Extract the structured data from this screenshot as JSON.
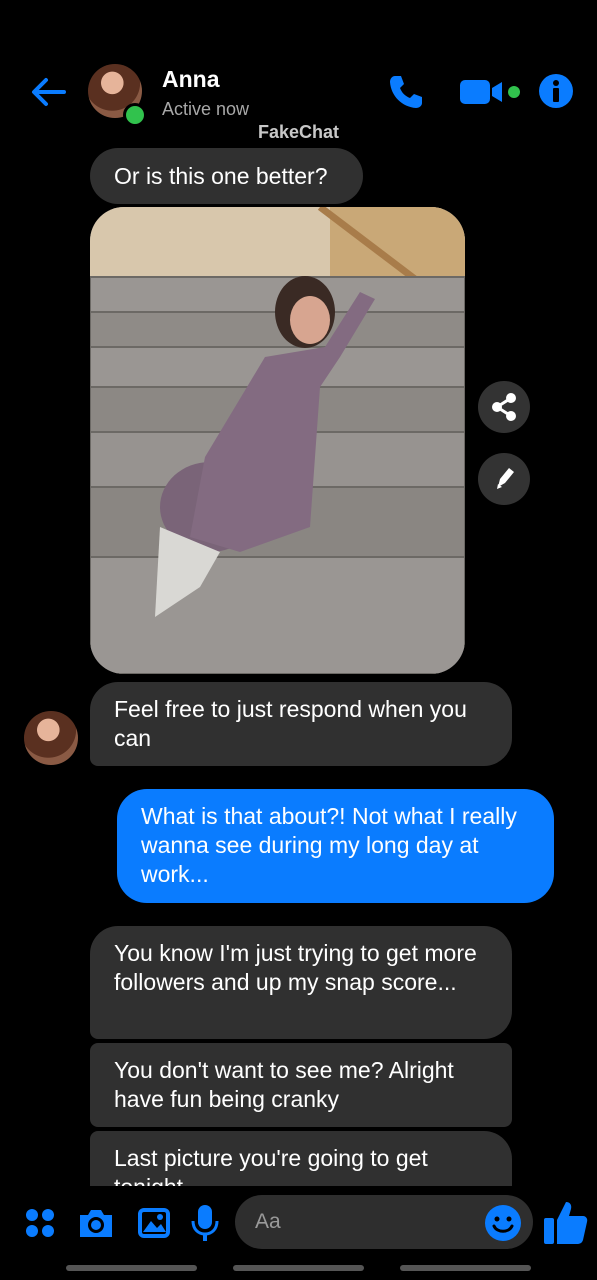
{
  "header": {
    "contact_name": "Anna",
    "status": "Active now",
    "watermark": "FakeChat",
    "accent": "#0a7cff",
    "online_color": "#31c24d"
  },
  "messages": [
    {
      "from": "contact",
      "text": "Or is this one better?"
    },
    {
      "from": "contact",
      "type": "photo"
    },
    {
      "from": "contact",
      "text": "Feel free to just respond when you can"
    },
    {
      "from": "me",
      "text": "What is that about?! Not what I really wanna see during my long day at work..."
    },
    {
      "from": "contact",
      "text": "You know I'm just trying to get more followers and up my snap score..."
    },
    {
      "from": "contact",
      "text": "You don't want to see me? Alright have fun being cranky"
    },
    {
      "from": "contact",
      "text": "Last picture you're going to get tonight"
    }
  ],
  "composer": {
    "placeholder": "Aa",
    "icons": [
      "menu-icon",
      "camera-icon",
      "gallery-icon",
      "mic-icon",
      "emoji-icon",
      "thumbs-up-icon"
    ]
  }
}
